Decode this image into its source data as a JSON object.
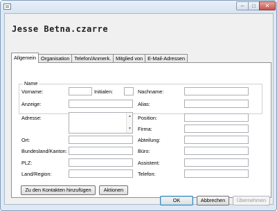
{
  "titlebar": {
    "minimize_glyph": "–",
    "maximize_glyph": "□",
    "close_glyph": "✕"
  },
  "header": {
    "contact_name": "Jesse Betna.czarre"
  },
  "tabs": [
    {
      "label": "Allgemein"
    },
    {
      "label": "Organisation"
    },
    {
      "label": "Telefon/Anmerk."
    },
    {
      "label": "Mitglied von"
    },
    {
      "label": "E-Mail-Adressen"
    }
  ],
  "general": {
    "name_group_title": "Name",
    "first_name_label": "Vorname:",
    "initials_label": "Initialen:",
    "last_name_label": "Nachname:",
    "display_label": "Anzeige:",
    "alias_label": "Alias:",
    "address_label": "Adresse:",
    "city_label": "Ort:",
    "state_label": "Bundesland/Kanton:",
    "zip_label": "PLZ:",
    "country_label": "Land/Region:",
    "position_label": "Position:",
    "company_label": "Firma:",
    "department_label": "Abteilung:",
    "office_label": "Büro:",
    "assistant_label": "Assistent:",
    "phone_label": "Telefon:",
    "add_contacts_button": "Zu den Kontakten hinzufügen",
    "actions_button": "Aktionen"
  },
  "footer": {
    "ok_button": "OK",
    "cancel_button": "Abbrechen",
    "apply_button": "Übernehmen"
  },
  "icons": {
    "scroll_up": "▲",
    "scroll_down": "▼",
    "resize_grip": "⋰"
  }
}
